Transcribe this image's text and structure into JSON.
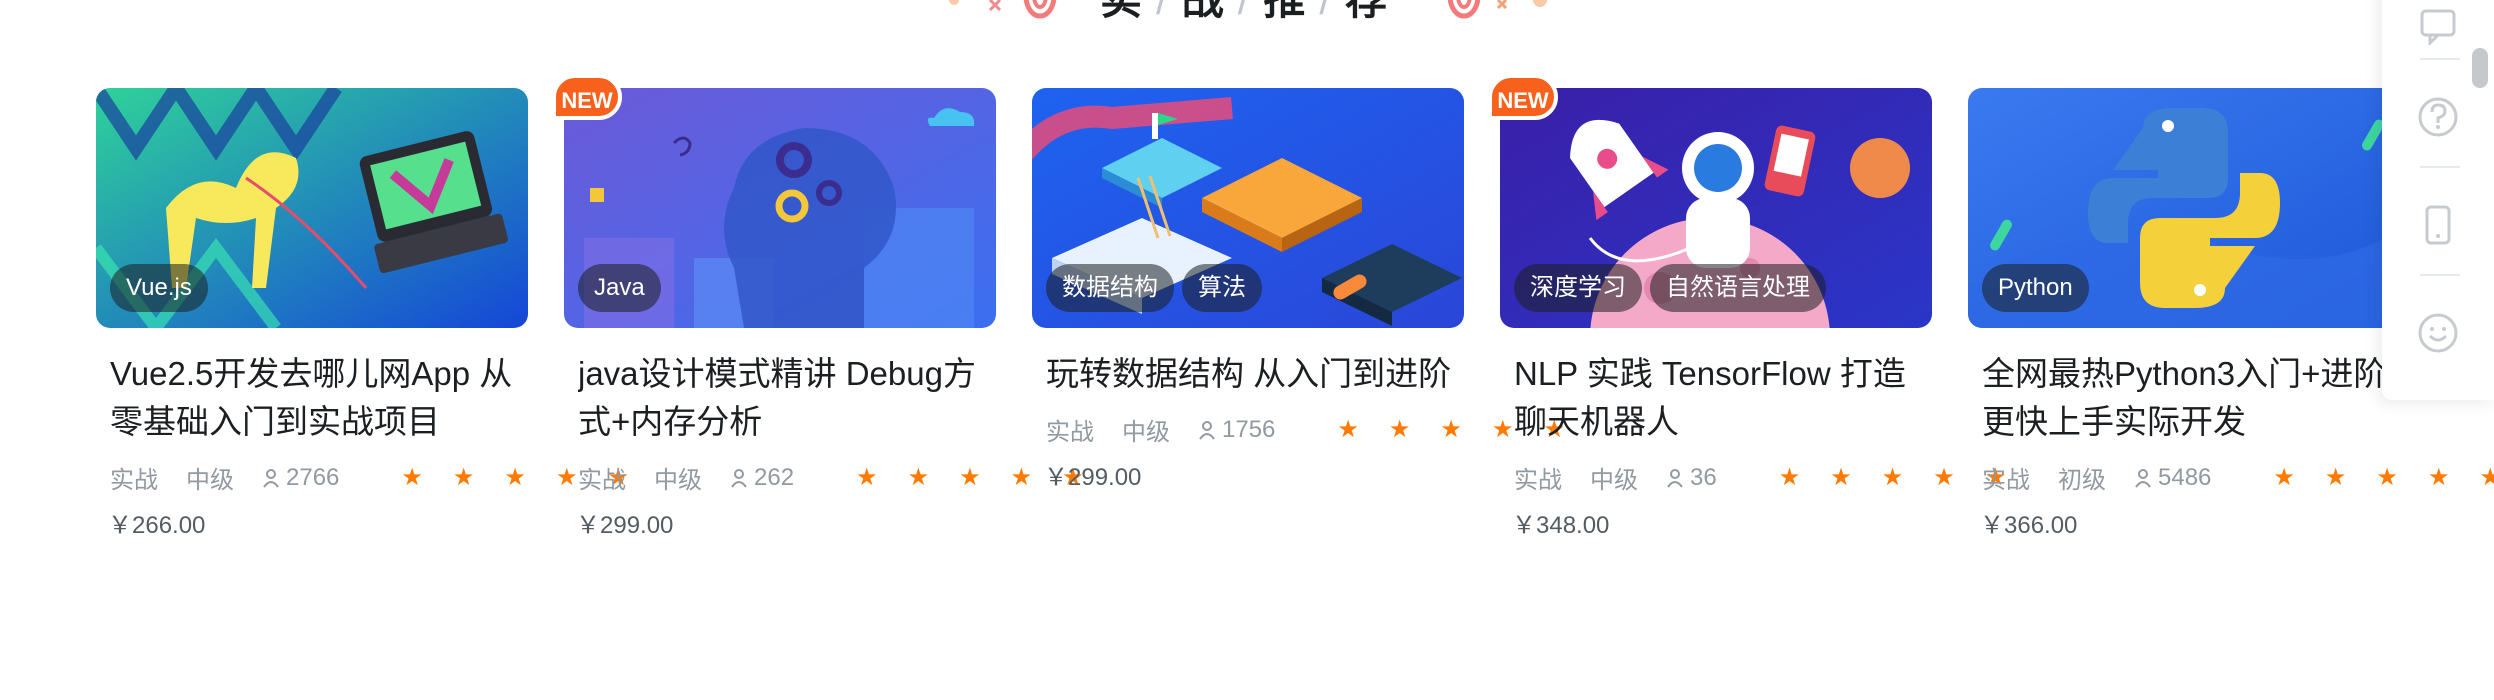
{
  "section": {
    "title_chars": [
      "实",
      "战",
      "推",
      "荐"
    ],
    "separator": "/"
  },
  "courses": [
    {
      "title": "Vue2.5开发去哪儿网App 从零基础入门到实战项目",
      "tags": [
        "Vue.js"
      ],
      "is_new": false,
      "type": "实战",
      "level": "中级",
      "students": "2766",
      "rating": 5,
      "price": "￥266.00",
      "thumb_icon": "camel-laptop-illustration"
    },
    {
      "title": "java设计模式精讲 Debug方式+内存分析",
      "tags": [
        "Java"
      ],
      "is_new": true,
      "type": "实战",
      "level": "中级",
      "students": "262",
      "rating": 5,
      "price": "￥299.00",
      "thumb_icon": "head-gears-illustration"
    },
    {
      "title": "玩转数据结构 从入门到进阶",
      "tags": [
        "数据结构",
        "算法"
      ],
      "is_new": false,
      "type": "实战",
      "level": "中级",
      "students": "1756",
      "rating": 5,
      "price": "￥299.00",
      "thumb_icon": "isometric-blocks-illustration"
    },
    {
      "title": "NLP 实践 TensorFlow 打造聊天机器人",
      "tags": [
        "深度学习",
        "自然语言处理"
      ],
      "is_new": true,
      "type": "实战",
      "level": "中级",
      "students": "36",
      "rating": 5,
      "price": "￥348.00",
      "thumb_icon": "astronaut-rocket-illustration"
    },
    {
      "title": "全网最热Python3入门+进阶 更快上手实际开发",
      "tags": [
        "Python"
      ],
      "is_new": false,
      "type": "实战",
      "level": "初级",
      "students": "5486",
      "rating": 5,
      "price": "￥366.00",
      "thumb_icon": "python-logo-illustration"
    }
  ],
  "badge_new": "NEW",
  "star_char": "★",
  "colors": {
    "accent_orange": "#f8611b",
    "star": "#ff7a00",
    "meta_text": "#9199a1",
    "price_text": "#545c63"
  },
  "sidebar": {
    "icons": [
      "chat-icon",
      "help-icon",
      "mobile-icon",
      "feedback-icon"
    ]
  }
}
